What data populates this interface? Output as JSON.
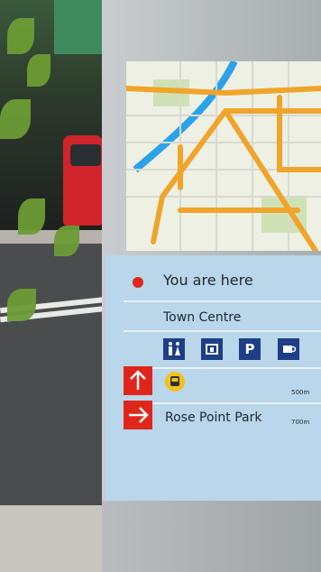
{
  "sign": {
    "you_are_here": "You are here",
    "town_centre": "Town Centre",
    "parking_label": "P",
    "bus_distance": "500m",
    "park_name": "Rose Point Park",
    "park_distance": "700m"
  },
  "colors": {
    "panel": "#b9d6ea",
    "marker_red": "#e0261b",
    "icon_blue": "#1c3f86",
    "map_road_orange": "#f0a42a",
    "map_river_blue": "#2aa3e8"
  },
  "icons": [
    "red-dot-icon",
    "toilets-icon",
    "information-icon",
    "parking-icon",
    "cafe-icon",
    "up-arrow-icon",
    "bus-icon",
    "right-arrow-icon"
  ]
}
